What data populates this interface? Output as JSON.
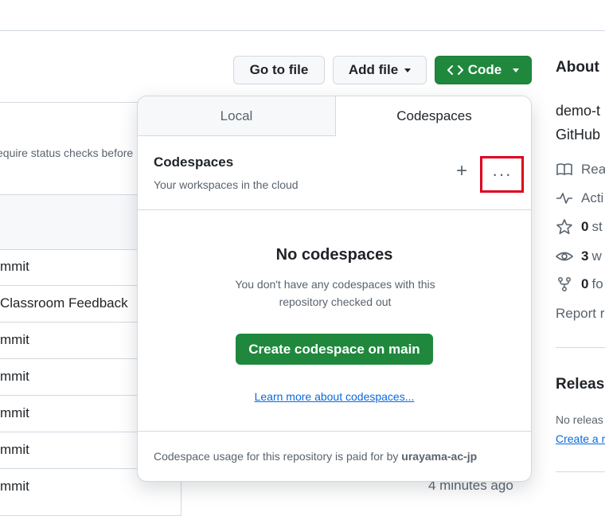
{
  "toolbar": {
    "go_to_file": "Go to file",
    "add_file": "Add file",
    "code": "Code"
  },
  "repo": {
    "commit_message_partial": "equire status checks before",
    "rows": [
      {
        "text": "mmit"
      },
      {
        "text": "Classroom Feedback"
      },
      {
        "text": "mmit"
      },
      {
        "text": "mmit"
      },
      {
        "text": "mmit"
      },
      {
        "text": "mmit"
      },
      {
        "text": "mmit"
      }
    ],
    "last_time": "4 minutes ago"
  },
  "about": {
    "title": "About",
    "desc_line1": "demo-t",
    "desc_line2": "GitHub",
    "readme": "Rea",
    "activity": "Acti",
    "stars_count": "0",
    "stars_label": "st",
    "watch_count": "3",
    "watch_label": "w",
    "forks_count": "0",
    "forks_label": "fo",
    "report": "Report r",
    "releases_title": "Release",
    "no_releases": "No releas",
    "create_release": "Create a r"
  },
  "dropdown": {
    "tabs": [
      {
        "label": "Local"
      },
      {
        "label": "Codespaces"
      }
    ],
    "section_title": "Codespaces",
    "section_subtitle": "Your workspaces in the cloud",
    "plus": "+",
    "more": "···",
    "empty_title": "No codespaces",
    "empty_desc": "You don't have any codespaces with this repository checked out",
    "create_button": "Create codespace on main",
    "learn_more": "Learn more about codespaces...",
    "footer_prefix": "Codespace usage for this repository is paid for by ",
    "footer_owner": "urayama-ac-jp"
  },
  "colors": {
    "primary_green": "#1f883d",
    "highlight_red": "#e0001b",
    "link_blue": "#0969da"
  }
}
